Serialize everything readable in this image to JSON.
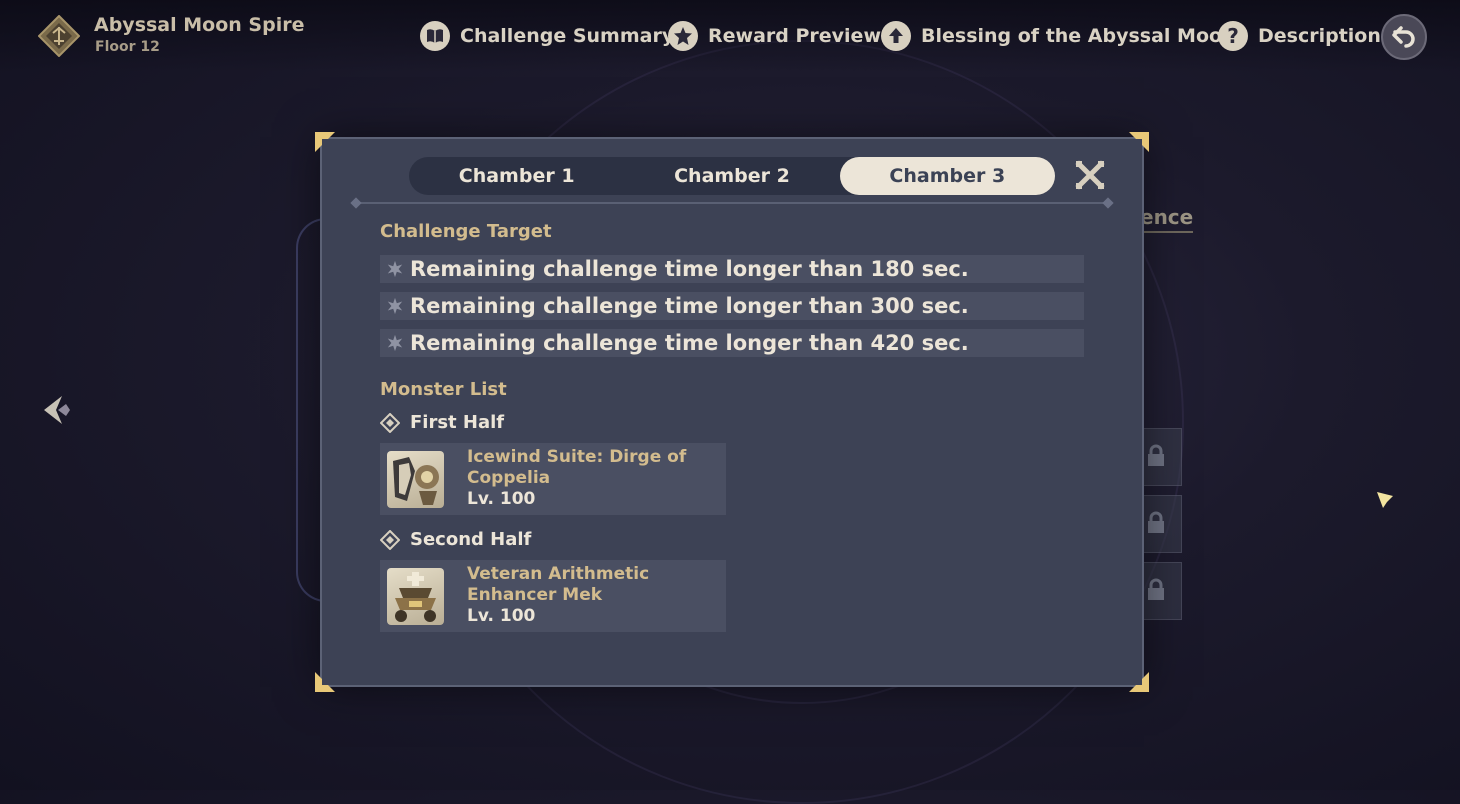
{
  "header": {
    "title": "Abyssal Moon Spire",
    "subtitle": "Floor 12",
    "nav": [
      {
        "label": "Challenge Summary",
        "icon": "book-icon"
      },
      {
        "label": "Reward Preview",
        "icon": "star-badge-icon"
      },
      {
        "label": "Blessing of the Abyssal Moon",
        "icon": "up-arrow-icon"
      },
      {
        "label": "Description",
        "icon": "question-icon"
      }
    ]
  },
  "background": {
    "partial_text": "ence"
  },
  "dialog": {
    "tabs": [
      {
        "label": "Chamber 1",
        "active": false
      },
      {
        "label": "Chamber 2",
        "active": false
      },
      {
        "label": "Chamber 3",
        "active": true
      }
    ],
    "challenge_target": {
      "title": "Challenge Target",
      "items": [
        "Remaining challenge time longer than 180 sec.",
        "Remaining challenge time longer than 300 sec.",
        "Remaining challenge time longer than 420 sec."
      ]
    },
    "monster_list": {
      "title": "Monster List",
      "halves": [
        {
          "label": "First Half",
          "monster": {
            "name": "Icewind Suite: Dirge of Coppelia",
            "level": "Lv. 100"
          }
        },
        {
          "label": "Second Half",
          "monster": {
            "name": "Veteran Arithmetic Enhancer Mek",
            "level": "Lv. 100"
          }
        }
      ]
    }
  },
  "colors": {
    "accent_gold": "#d3bc8e",
    "panel": "#3d4255",
    "tab_active": "#ece5d8"
  }
}
